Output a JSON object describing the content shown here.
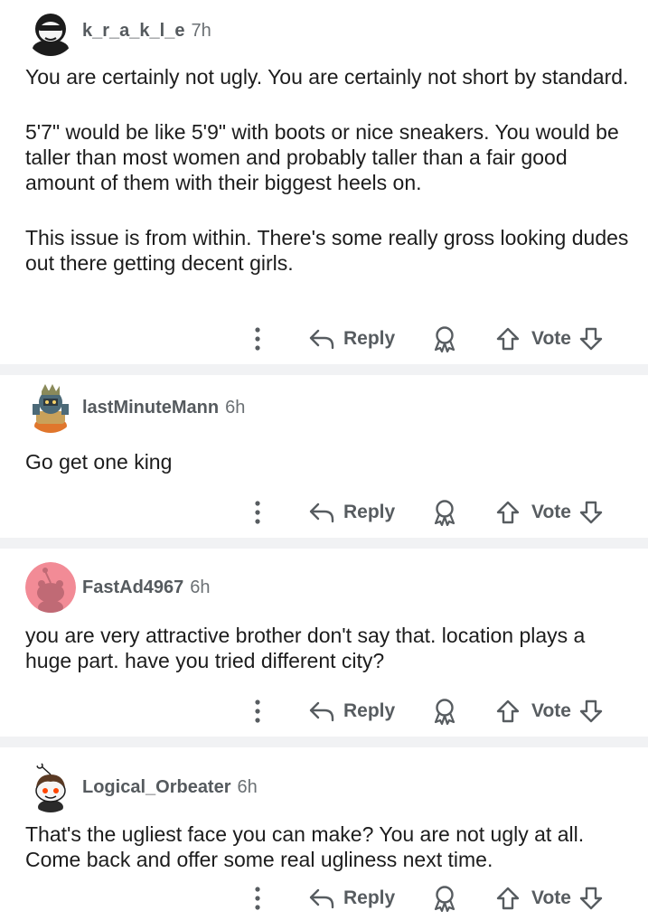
{
  "comments": [
    {
      "username": "k_r_a_k_l_e",
      "time": "7h",
      "avatar": "sunglasses-avatar",
      "paragraphs": [
        "You are certainly not ugly. You are certainly not short by standard.",
        "5'7\" would be like 5'9\" with boots or nice sneakers. You would be taller than most women and probably taller than a fair good amount of them with their biggest heels on.",
        "This issue is from within. There's some really gross looking dudes out there getting decent girls."
      ]
    },
    {
      "username": "lastMinuteMann",
      "time": "6h",
      "avatar": "armored-avatar",
      "paragraphs": [
        "Go get one king"
      ]
    },
    {
      "username": "FastAd4967",
      "time": "6h",
      "avatar": "default-pink-avatar",
      "paragraphs": [
        "you are very attractive brother don't say that. location plays a huge part. have you tried different city?"
      ]
    },
    {
      "username": "Logical_Orbeater",
      "time": "6h",
      "avatar": "snoo-avatar",
      "paragraphs": [
        "That's the ugliest face you can make? You are not ugly at all. Come back and offer some real ugliness next time."
      ]
    }
  ],
  "actions": {
    "reply_label": "Reply",
    "vote_label": "Vote",
    "more_icon": "more-vertical-icon",
    "reply_icon": "reply-arrow-icon",
    "award_icon": "award-icon",
    "upvote_icon": "arrow-up-icon",
    "downvote_icon": "arrow-down-icon"
  },
  "colors": {
    "text": "#1c1c1c",
    "meta": "#555a5e",
    "icon": "#575c60",
    "separator": "#f1f2f4",
    "avatar_pink": "#f28b96",
    "snoo_orange": "#ff4500"
  }
}
